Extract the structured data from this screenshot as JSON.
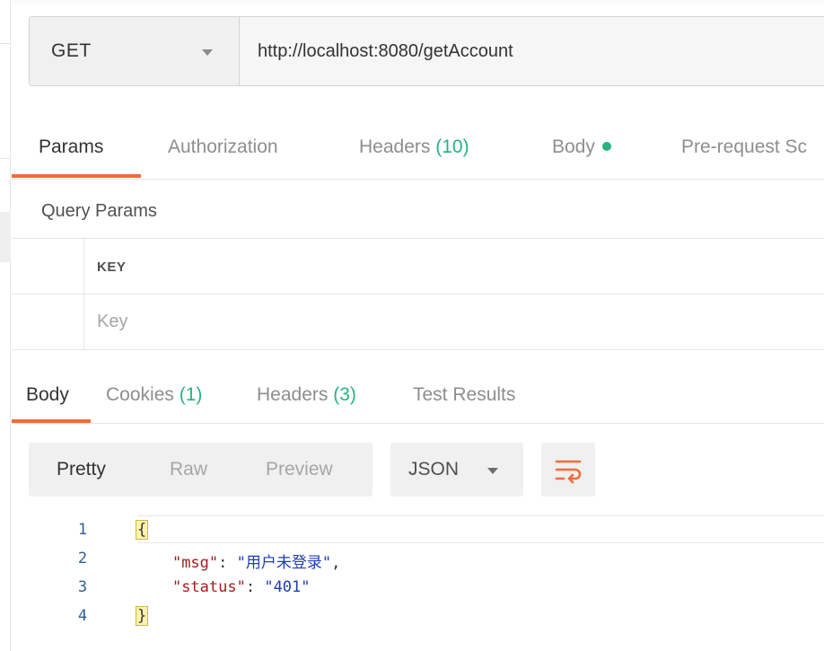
{
  "request": {
    "method": "GET",
    "url": "http://localhost:8080/getAccount"
  },
  "request_tabs": {
    "params": "Params",
    "authorization": "Authorization",
    "headers": "Headers",
    "headers_count": "(10)",
    "body": "Body",
    "pre_request": "Pre-request Sc"
  },
  "query_params": {
    "title": "Query Params",
    "key_header": "KEY",
    "key_placeholder": "Key"
  },
  "response_tabs": {
    "body": "Body",
    "cookies": "Cookies",
    "cookies_count": "(1)",
    "headers": "Headers",
    "headers_count": "(3)",
    "test_results": "Test Results"
  },
  "response_toolbar": {
    "pretty": "Pretty",
    "raw": "Raw",
    "preview": "Preview",
    "format": "JSON"
  },
  "code": {
    "line_numbers": [
      "1",
      "2",
      "3",
      "4"
    ],
    "open_brace": "{",
    "close_brace": "}",
    "msg_key": "\"msg\"",
    "msg_value": "\"用户未登录\"",
    "status_key": "\"status\"",
    "status_value": "\"401\""
  },
  "colors": {
    "accent": "#f26b3a",
    "success": "#26b47f"
  }
}
